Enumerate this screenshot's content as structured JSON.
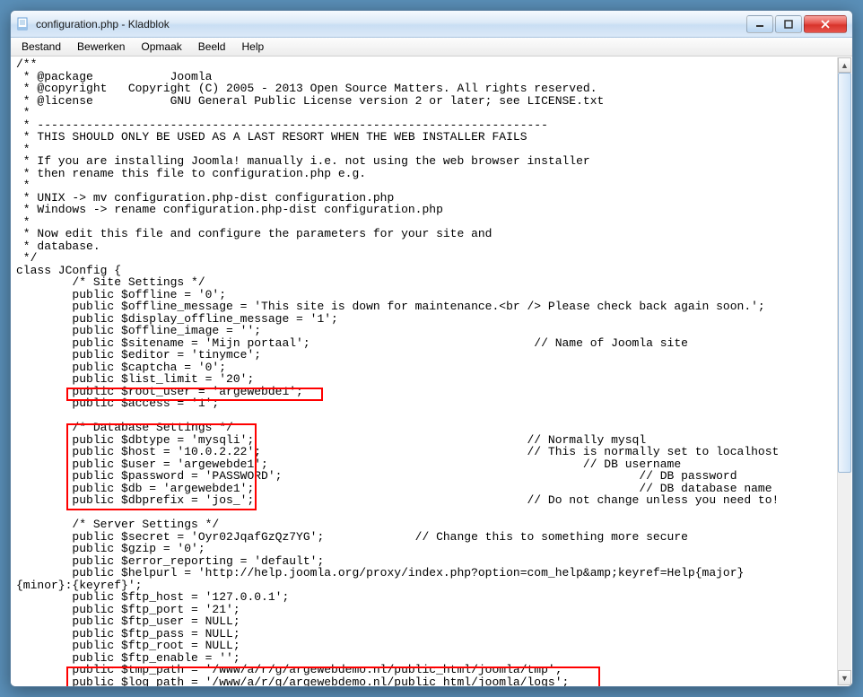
{
  "window": {
    "title": "configuration.php - Kladblok"
  },
  "menu": {
    "file": "Bestand",
    "edit": "Bewerken",
    "format": "Opmaak",
    "view": "Beeld",
    "help": "Help"
  },
  "code": {
    "l1": "/**",
    "l2": " * @package           Joomla",
    "l3": " * @copyright   Copyright (C) 2005 - 2013 Open Source Matters. All rights reserved.",
    "l4": " * @license           GNU General Public License version 2 or later; see LICENSE.txt",
    "l5": " *",
    "l6": " * -------------------------------------------------------------------------",
    "l7": " * THIS SHOULD ONLY BE USED AS A LAST RESORT WHEN THE WEB INSTALLER FAILS",
    "l8": " *",
    "l9": " * If you are installing Joomla! manually i.e. not using the web browser installer",
    "l10": " * then rename this file to configuration.php e.g.",
    "l11": " *",
    "l12": " * UNIX -> mv configuration.php-dist configuration.php",
    "l13": " * Windows -> rename configuration.php-dist configuration.php",
    "l14": " *",
    "l15": " * Now edit this file and configure the parameters for your site and",
    "l16": " * database.",
    "l17": " */",
    "l18": "class JConfig {",
    "l19": "        /* Site Settings */",
    "l20": "        public $offline = '0';",
    "l21": "        public $offline_message = 'This site is down for maintenance.<br /> Please check back again soon.';",
    "l22": "        public $display_offline_message = '1';",
    "l23": "        public $offline_image = '';",
    "l24": "        public $sitename = 'Mijn portaal';                                // Name of Joomla site",
    "l25": "        public $editor = 'tinymce';",
    "l26": "        public $captcha = '0';",
    "l27": "        public $list_limit = '20';",
    "l28": "        public $root_user = 'argewebde1';",
    "l29": "        public $access = '1';",
    "l30": "",
    "l31": "        /* Database Settings */",
    "l32": "        public $dbtype = 'mysqli';                                       // Normally mysql",
    "l33": "        public $host = '10.0.2.22';                                      // This is normally set to localhost",
    "l34": "        public $user = 'argewebde1';                                             // DB username",
    "l35": "        public $password = 'PASSWORD';                                                   // DB password",
    "l36": "        public $db = 'argewebde1';                                                       // DB database name",
    "l37": "        public $dbprefix = 'jos_';                                       // Do not change unless you need to!",
    "l38": "",
    "l39": "        /* Server Settings */",
    "l40": "        public $secret = 'Oyr02JqafGzQz7YG';             // Change this to something more secure",
    "l41": "        public $gzip = '0';",
    "l42": "        public $error_reporting = 'default';",
    "l43": "        public $helpurl = 'http://help.joomla.org/proxy/index.php?option=com_help&amp;keyref=Help{major}",
    "l44": "{minor}:{keyref}';",
    "l45": "        public $ftp_host = '127.0.0.1';",
    "l46": "        public $ftp_port = '21';",
    "l47": "        public $ftp_user = NULL;",
    "l48": "        public $ftp_pass = NULL;",
    "l49": "        public $ftp_root = NULL;",
    "l50": "        public $ftp_enable = '';",
    "l51": "        public $tmp_path = '/www/a/r/g/argewebdemo.nl/public_html/joomla/tmp';",
    "l52": "        public $log_path = '/www/a/r/g/argewebdemo.nl/public_html/joomla/logs';"
  }
}
